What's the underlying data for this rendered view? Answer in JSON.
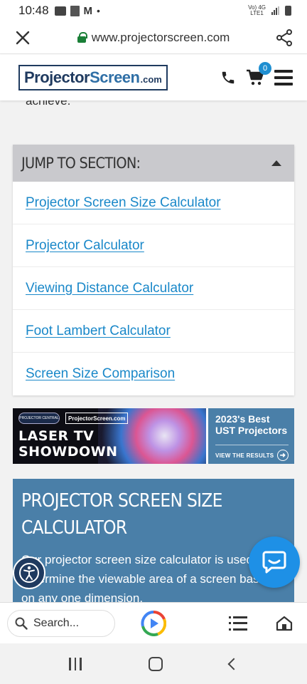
{
  "status_bar": {
    "time": "10:48",
    "network_top": "Vo) 4G",
    "network_bottom": "LTE1"
  },
  "browser": {
    "url": "www.projectorscreen.com"
  },
  "site": {
    "logo_projector": "Projector",
    "logo_screen": "Screen",
    "logo_com": ".com",
    "cart_count": "0"
  },
  "intro": {
    "text": "achieve."
  },
  "jump_section": {
    "title": "JUMP TO SECTION:",
    "items": [
      {
        "label": "Projector Screen Size Calculator"
      },
      {
        "label": "Projector Calculator"
      },
      {
        "label": "Viewing Distance Calculator"
      },
      {
        "label": "Foot Lambert Calculator"
      },
      {
        "label": "Screen Size Comparison"
      }
    ]
  },
  "banner": {
    "headline_line1": "LASER TV",
    "headline_line2": "SHOWDOWN",
    "logo_left": "PROJECTOR CENTRAL",
    "logo_right": "ProjectorScreen.com",
    "right_title_line1": "2023's Best",
    "right_title_line2": "UST Projectors",
    "cta": "VIEW THE RESULTS"
  },
  "calculator": {
    "title": "PROJECTOR SCREEN SIZE CALCULATOR",
    "text": "Our projector screen size calculator is used to determine the viewable area of a screen based on any one dimension."
  },
  "bottom_bar": {
    "search_placeholder": "Search..."
  },
  "colors": {
    "link": "#1a88c9",
    "section_blue": "#4a7fa8",
    "chat_blue": "#1e90e6",
    "brand_navy": "#1f3a5f"
  }
}
